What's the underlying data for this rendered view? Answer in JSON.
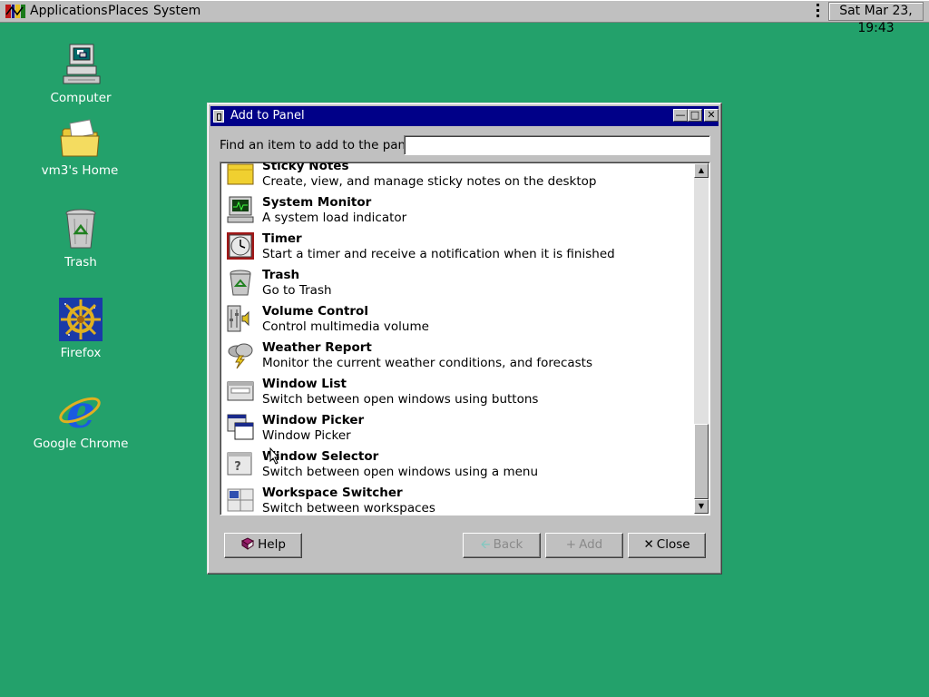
{
  "top_panel": {
    "menus": [
      "Applications",
      "Places",
      "System"
    ],
    "clock": "Sat Mar 23, 19:43"
  },
  "desktop_icons": [
    {
      "label": "Computer",
      "icon": "computer-icon"
    },
    {
      "label": "vm3's Home",
      "icon": "home-folder-icon"
    },
    {
      "label": "Trash",
      "icon": "trash-icon"
    },
    {
      "label": "Firefox",
      "icon": "ship-wheel-icon"
    },
    {
      "label": "Google Chrome",
      "icon": "internet-explorer-icon"
    }
  ],
  "dialog": {
    "title": "Add to Panel",
    "find_label": "Find an item to add to the panel:",
    "find_value": "",
    "items": [
      {
        "name": "Sticky Notes",
        "desc": "Create, view, and manage sticky notes on the desktop",
        "icon": "sticky-notes-icon"
      },
      {
        "name": "System Monitor",
        "desc": "A system load indicator",
        "icon": "system-monitor-icon"
      },
      {
        "name": "Timer",
        "desc": "Start a timer and receive a notification when it is finished",
        "icon": "timer-icon"
      },
      {
        "name": "Trash",
        "desc": "Go to Trash",
        "icon": "trash-icon"
      },
      {
        "name": "Volume Control",
        "desc": "Control multimedia volume",
        "icon": "volume-control-icon"
      },
      {
        "name": "Weather Report",
        "desc": "Monitor the current weather conditions, and forecasts",
        "icon": "weather-icon"
      },
      {
        "name": "Window List",
        "desc": "Switch between open windows using buttons",
        "icon": "window-list-icon"
      },
      {
        "name": "Window Picker",
        "desc": "Window Picker",
        "icon": "window-picker-icon"
      },
      {
        "name": "Window Selector",
        "desc": "Switch between open windows using a menu",
        "icon": "window-selector-icon"
      },
      {
        "name": "Workspace Switcher",
        "desc": "Switch between workspaces",
        "icon": "workspace-switcher-icon"
      }
    ],
    "buttons": {
      "help": "Help",
      "back": "Back",
      "add": "Add",
      "close": "Close"
    }
  }
}
